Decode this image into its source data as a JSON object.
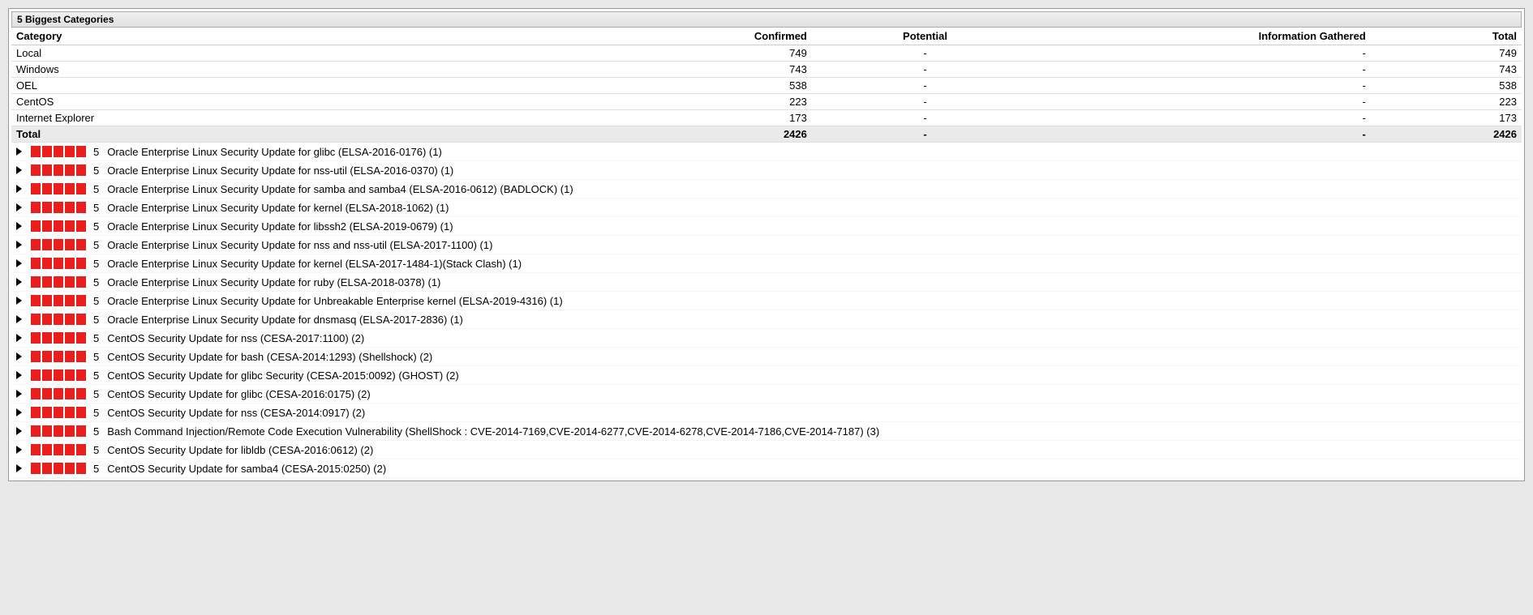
{
  "panel_title": "5 Biggest Categories",
  "table_headers": {
    "category": "Category",
    "confirmed": "Confirmed",
    "potential": "Potential",
    "info": "Information Gathered",
    "total": "Total"
  },
  "categories": [
    {
      "name": "Local",
      "confirmed": "749",
      "potential": "-",
      "info": "-",
      "total": "749"
    },
    {
      "name": "Windows",
      "confirmed": "743",
      "potential": "-",
      "info": "-",
      "total": "743"
    },
    {
      "name": "OEL",
      "confirmed": "538",
      "potential": "-",
      "info": "-",
      "total": "538"
    },
    {
      "name": "CentOS",
      "confirmed": "223",
      "potential": "-",
      "info": "-",
      "total": "223"
    },
    {
      "name": "Internet Explorer",
      "confirmed": "173",
      "potential": "-",
      "info": "-",
      "total": "173"
    }
  ],
  "totals": {
    "label": "Total",
    "confirmed": "2426",
    "potential": "-",
    "info": "-",
    "total": "2426"
  },
  "vulnerabilities": [
    {
      "severity": "5",
      "title": "Oracle Enterprise Linux Security Update for glibc (ELSA-2016-0176) (1)"
    },
    {
      "severity": "5",
      "title": "Oracle Enterprise Linux Security Update for nss-util (ELSA-2016-0370) (1)"
    },
    {
      "severity": "5",
      "title": "Oracle Enterprise Linux Security Update for samba and samba4 (ELSA-2016-0612) (BADLOCK) (1)"
    },
    {
      "severity": "5",
      "title": "Oracle Enterprise Linux Security Update for kernel (ELSA-2018-1062) (1)"
    },
    {
      "severity": "5",
      "title": "Oracle Enterprise Linux Security Update for libssh2 (ELSA-2019-0679) (1)"
    },
    {
      "severity": "5",
      "title": "Oracle Enterprise Linux Security Update for nss and nss-util (ELSA-2017-1100) (1)"
    },
    {
      "severity": "5",
      "title": "Oracle Enterprise Linux Security Update for kernel (ELSA-2017-1484-1)(Stack Clash) (1)"
    },
    {
      "severity": "5",
      "title": "Oracle Enterprise Linux Security Update for ruby (ELSA-2018-0378) (1)"
    },
    {
      "severity": "5",
      "title": "Oracle Enterprise Linux Security Update for Unbreakable Enterprise kernel (ELSA-2019-4316) (1)"
    },
    {
      "severity": "5",
      "title": "Oracle Enterprise Linux Security Update for dnsmasq (ELSA-2017-2836) (1)"
    },
    {
      "severity": "5",
      "title": "CentOS Security Update for nss (CESA-2017:1100) (2)"
    },
    {
      "severity": "5",
      "title": "CentOS Security Update for bash (CESA-2014:1293) (Shellshock) (2)"
    },
    {
      "severity": "5",
      "title": "CentOS Security Update for glibc Security (CESA-2015:0092) (GHOST) (2)"
    },
    {
      "severity": "5",
      "title": "CentOS Security Update for glibc (CESA-2016:0175) (2)"
    },
    {
      "severity": "5",
      "title": "CentOS Security Update for nss (CESA-2014:0917) (2)"
    },
    {
      "severity": "5",
      "title": "Bash Command Injection/Remote Code Execution Vulnerability (ShellShock : CVE-2014-7169,CVE-2014-6277,CVE-2014-6278,CVE-2014-7186,CVE-2014-7187) (3)"
    },
    {
      "severity": "5",
      "title": "CentOS Security Update for libldb (CESA-2016:0612) (2)"
    },
    {
      "severity": "5",
      "title": "CentOS Security Update for samba4 (CESA-2015:0250) (2)"
    }
  ]
}
